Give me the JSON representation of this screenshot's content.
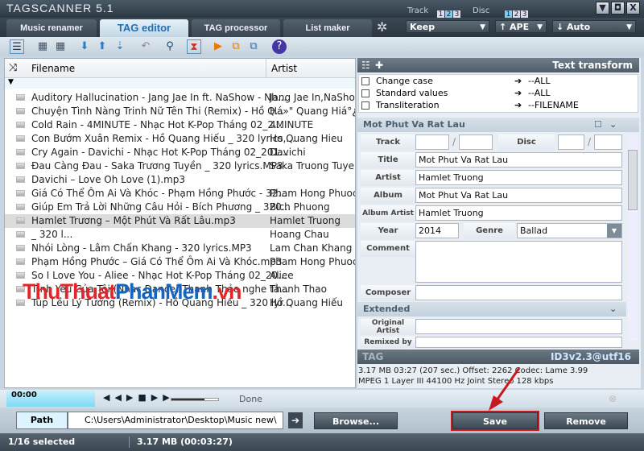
{
  "app": {
    "title": "TAGSCANNER 5.1",
    "min": "▼",
    "max": "◘",
    "close": "X"
  },
  "tabs": [
    {
      "label": "Music renamer"
    },
    {
      "label": "TAG editor"
    },
    {
      "label": "TAG processor"
    },
    {
      "label": "List maker"
    }
  ],
  "track": {
    "label": "Track",
    "nums": [
      "1",
      "2",
      "3"
    ]
  },
  "disc": {
    "label": "Disc",
    "nums": [
      "1",
      "2",
      "3"
    ]
  },
  "dropdowns": {
    "keep": "Keep",
    "ape": "↑ APE",
    "auto": "↓ Auto"
  },
  "list": {
    "columns": {
      "filename": "Filename",
      "artist": "Artist"
    },
    "rows": [
      {
        "filename": "Auditory Hallucination - Jang Jae In ft. NaShow - Nh...",
        "artist": "Jang Jae In,NaShow"
      },
      {
        "filename": "Chuyện Tình Nàng Trinh Nữ Tên Thi (Remix) - Hồ Q...",
        "artist": "Há»\" Quang Hiá°¿u"
      },
      {
        "filename": "Cold Rain - 4MINUTE - Nhạc Hot K-Pop Tháng 02_2...",
        "artist": "4MINUTE"
      },
      {
        "filename": "Con Bướm Xuân Remix - Hồ Quang Hiếu _ 320 lyrics,...",
        "artist": "Ho Quang Hieu"
      },
      {
        "filename": "Cry Again - Davichi - Nhạc Hot K-Pop Tháng 02_201...",
        "artist": "Davichi"
      },
      {
        "filename": "Đau Càng Đau - Saka Trương Tuyền _ 320 lyrics.MP3",
        "artist": "Saka Truong Tuyen"
      },
      {
        "filename": "Davichi – Love Oh Love (1).mp3",
        "artist": ""
      },
      {
        "filename": "Giá Có Thể Ôm Ai Và Khóc - Phạm Hồng Phước - 32...",
        "artist": "Pham Hong Phuoc"
      },
      {
        "filename": "Giúp Em Trả Lời Những Câu Hỏi - Bích Phương _ 320...",
        "artist": "Bich Phuong"
      },
      {
        "filename": "Hamlet Trương – Một Phút Và Rất Lâu.mp3",
        "artist": "Hamlet Truong"
      },
      {
        "filename": "_ 320 l...",
        "artist": "Hoang Chau"
      },
      {
        "filename": "Nhói Lòng - Lâm Chấn Khang - 320 lyrics.MP3",
        "artist": "Lam Chan Khang"
      },
      {
        "filename": "Phạm Hồng Phước – Giá Có Thể Ôm Ai Và Khóc.mp3",
        "artist": "Pham Hong Phuoc"
      },
      {
        "filename": "So I Love You - Aliee - Nhạc Hot K-Pop Tháng 02_20...",
        "artist": "Aliee"
      },
      {
        "filename": "Tình Yêu Của Tôi (Nhạc Dance) Thanh Thảo nghe tả...",
        "artist": "Thanh Thao"
      },
      {
        "filename": "Túp Lều Lý Tưởng (Remix) - Hồ Quang Hiếu _ 320 lyr...",
        "artist": "Hồ Quang Hiếu"
      }
    ]
  },
  "watermark": {
    "part1": "ThuThuat",
    "part2": "PhanMem",
    "part3": ".vn"
  },
  "transform": {
    "title": "Text transform",
    "items": [
      {
        "label": "Change case",
        "target": "--ALL"
      },
      {
        "label": "Standard values",
        "target": "--ALL"
      },
      {
        "label": "Transliteration",
        "target": "--FILENAME"
      }
    ]
  },
  "main": {
    "title": "Mot Phut Va Rat Lau",
    "track_label": "Track",
    "disc_label": "Disc",
    "title_label": "Title",
    "artist_label": "Artist",
    "artist": "Hamlet Truong",
    "album_label": "Album",
    "album": "Mot Phut Va Rat Lau",
    "album_artist_label": "Album Artist",
    "album_artist": "Hamlet Truong",
    "year_label": "Year",
    "year": "2014",
    "genre_label": "Genre",
    "genre": "Ballad",
    "comment_label": "Comment",
    "composer_label": "Composer"
  },
  "extended": {
    "title": "Extended",
    "original_artist_label": "Original Artist",
    "remixed_by_label": "Remixed by"
  },
  "tag": {
    "label": "TAG",
    "version": "ID3v2.3@utf16",
    "info1": "3.17 MB 03:27 (207 sec.)  Offset: 2262  Codec: Lame 3.99",
    "info2": "MPEG 1 Layer III  44100 Hz  Joint Stereo  128 kbps"
  },
  "player": {
    "time": "00:00",
    "status": "Done",
    "progress": 0
  },
  "pathbar": {
    "label": "Path",
    "value": "C:\\Users\\Administrator\\Desktop\\Music new\\",
    "browse": "Browse...",
    "save": "Save",
    "remove": "Remove"
  },
  "status": {
    "selected": "1/16 selected",
    "size": "3.17 MB (00:03:27)"
  }
}
